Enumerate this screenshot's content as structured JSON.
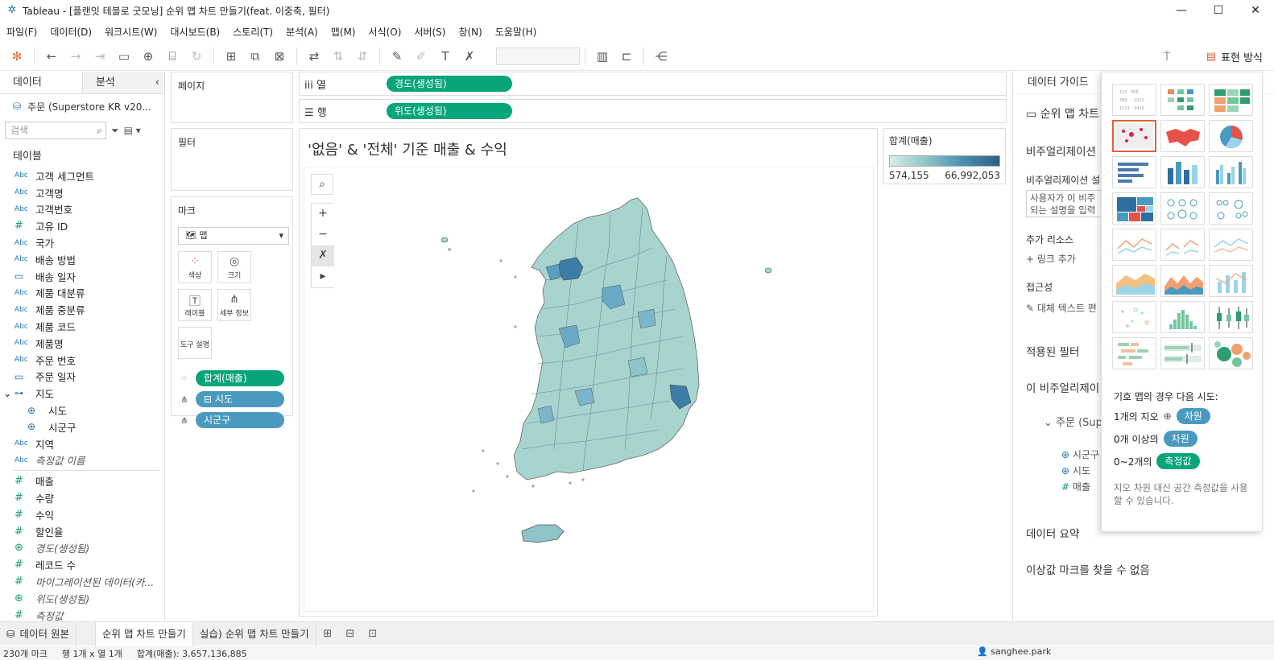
{
  "window": {
    "title": "Tableau - [플랜잇 테블로 굿모닝] 순위 맵 차트 만들기(feat. 이중축, 필터)",
    "minimize": "—",
    "maximize": "☐",
    "close": "✕"
  },
  "menu": [
    "파일(F)",
    "데이터(D)",
    "워크시트(W)",
    "대시보드(B)",
    "스토리(T)",
    "분석(A)",
    "맵(M)",
    "서식(O)",
    "서버(S)",
    "창(N)",
    "도움말(H)"
  ],
  "toolbar": {
    "present_label": "표현 방식"
  },
  "data_pane": {
    "tab_data": "데이터",
    "tab_analysis": "분석",
    "datasource": "주문 (Superstore KR v20...",
    "search_placeholder": "검색",
    "tables_header": "테이블",
    "fields": [
      {
        "type": "Abc",
        "name": "고객 세그먼트"
      },
      {
        "type": "Abc",
        "name": "고객명"
      },
      {
        "type": "Abc",
        "name": "고객번호"
      },
      {
        "type": "#",
        "name": "고유 ID"
      },
      {
        "type": "Abc",
        "name": "국가"
      },
      {
        "type": "Abc",
        "name": "배송 방법"
      },
      {
        "type": "date",
        "name": "배송 일자"
      },
      {
        "type": "Abc",
        "name": "제품 대분류"
      },
      {
        "type": "Abc",
        "name": "제품 중분류"
      },
      {
        "type": "Abc",
        "name": "제품 코드"
      },
      {
        "type": "Abc",
        "name": "제품명"
      },
      {
        "type": "Abc",
        "name": "주문 번호"
      },
      {
        "type": "date",
        "name": "주문 일자"
      }
    ],
    "geo_group": "지도",
    "geo_fields": [
      "시도",
      "시군구"
    ],
    "after_geo": [
      {
        "type": "Abc",
        "name": "지역"
      },
      {
        "type": "Abc",
        "name": "측정값 이름"
      }
    ],
    "measures": [
      {
        "type": "#",
        "name": "매출"
      },
      {
        "type": "#",
        "name": "수량"
      },
      {
        "type": "#",
        "name": "수익"
      },
      {
        "type": "#",
        "name": "할인율"
      },
      {
        "type": "geo",
        "name": "경도(생성됨)"
      },
      {
        "type": "#",
        "name": "레코드 수"
      },
      {
        "type": "#",
        "name": "마이그레이션된 데이터(카..."
      },
      {
        "type": "geo",
        "name": "위도(생성됨)"
      },
      {
        "type": "#",
        "name": "측정값"
      }
    ]
  },
  "cards": {
    "pages": "페이지",
    "filters": "필터",
    "marks": "마크",
    "marks_type": "맵",
    "mark_buttons": [
      "색상",
      "크기",
      "레이블",
      "세부 정보",
      "도구 설명"
    ],
    "mark_pills": [
      "합계(매출)",
      "시도",
      "시군구"
    ]
  },
  "shelves": {
    "columns_label": "열",
    "columns_pill": "경도(생성됨)",
    "rows_label": "행",
    "rows_pill": "위도(생성됨)"
  },
  "view": {
    "title": "'없음' & '전체' 기준 매출 & 수익"
  },
  "legend": {
    "title": "합계(매출)",
    "min": "574,155",
    "max": "66,992,053",
    "colors": [
      "#d6ede8",
      "#8fc4c8",
      "#4a8fb0",
      "#2e5f85"
    ]
  },
  "guide": {
    "header": "데이터 가이드",
    "sheet_name": "순위 맵 차트",
    "viz_section": "비주얼리제이션",
    "viz_desc_label": "비주얼리제이션 설",
    "viz_desc_text1": "사용자가 이 비주",
    "viz_desc_text2": "되는 설명을 입력",
    "extra_resources": "추가 리소스",
    "add_link": "링크 추가",
    "accessibility": "접근성",
    "alt_text": "대체 텍스트 편",
    "applied_filters": "적용된 필터",
    "this_viz": "이 비주얼리제이",
    "datasource_short": "주문 (Supe",
    "fields": [
      "시군구",
      "시도",
      "매출"
    ],
    "data_summary": "데이터 요약",
    "outliers": "이상값 마크를 찾을 수 없음"
  },
  "show_me": {
    "hint_title": "기호 맵의 경우 다음 시도:",
    "row1_prefix": "1개의 지오",
    "row1_pill": "차원",
    "row2_prefix": "0개 이상의",
    "row2_pill": "차원",
    "row3_prefix": "0~2개의",
    "row3_pill": "측정값",
    "note": "지오 차원 대신 공간 측정값을 사용할 수 있습니다."
  },
  "sheet_tabs": {
    "datasource": "데이터 원본",
    "sheet1": "순위 맵 차트 만들기",
    "sheet2": "실습) 순위 맵 차트 만들기"
  },
  "status": {
    "marks": "230개 마크",
    "rows_cols": "행 1개 x 열 1개",
    "sum": "합계(매출): 3,657,136,885",
    "user": "sanghee.park"
  }
}
